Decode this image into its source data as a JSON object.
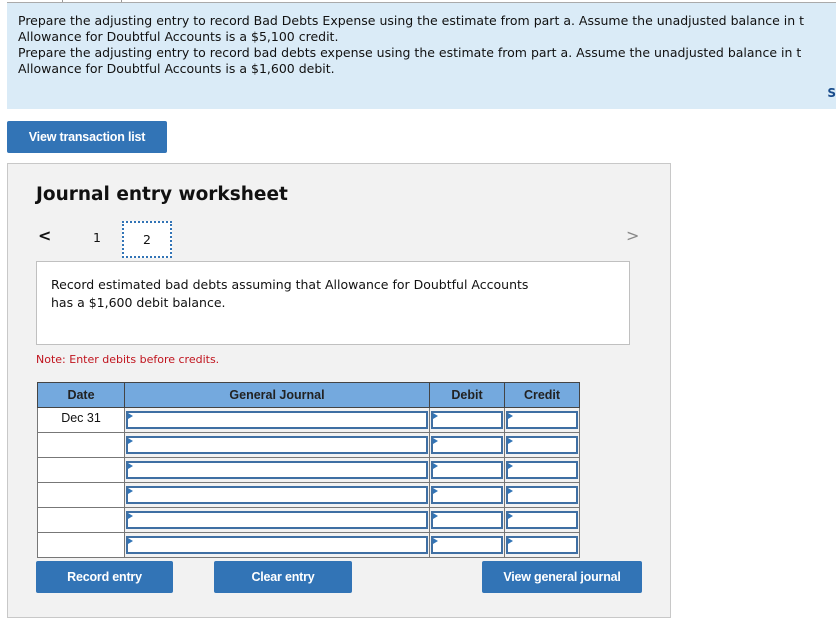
{
  "prompt": {
    "line1": "Prepare the adjusting entry to record Bad Debts Expense using the estimate from part a. Assume the unadjusted balance in t",
    "line2": "Allowance for Doubtful Accounts is a $5,100 credit.",
    "line3": "Prepare the adjusting entry to record bad debts expense using the estimate from part a. Assume the unadjusted balance in t",
    "line4": "Allowance for Doubtful Accounts is a $1,600 debit.",
    "clipped_link": "S"
  },
  "buttons": {
    "view_transaction_list": "View transaction list",
    "record_entry": "Record entry",
    "clear_entry": "Clear entry",
    "view_general_journal": "View general journal"
  },
  "worksheet": {
    "title": "Journal entry worksheet",
    "prev_icon": "<",
    "next_icon": ">",
    "steps": [
      "1",
      "2"
    ],
    "active_step": "2",
    "description_line1": "Record estimated bad debts assuming that Allowance for Doubtful Accounts",
    "description_line2": "has a $1,600 debit balance.",
    "note": "Note: Enter debits before credits."
  },
  "table": {
    "headers": [
      "Date",
      "General Journal",
      "Debit",
      "Credit"
    ],
    "rows": [
      {
        "date": "Dec 31",
        "account": "",
        "debit": "",
        "credit": ""
      },
      {
        "date": "",
        "account": "",
        "debit": "",
        "credit": ""
      },
      {
        "date": "",
        "account": "",
        "debit": "",
        "credit": ""
      },
      {
        "date": "",
        "account": "",
        "debit": "",
        "credit": ""
      },
      {
        "date": "",
        "account": "",
        "debit": "",
        "credit": ""
      },
      {
        "date": "",
        "account": "",
        "debit": "",
        "credit": ""
      }
    ]
  }
}
